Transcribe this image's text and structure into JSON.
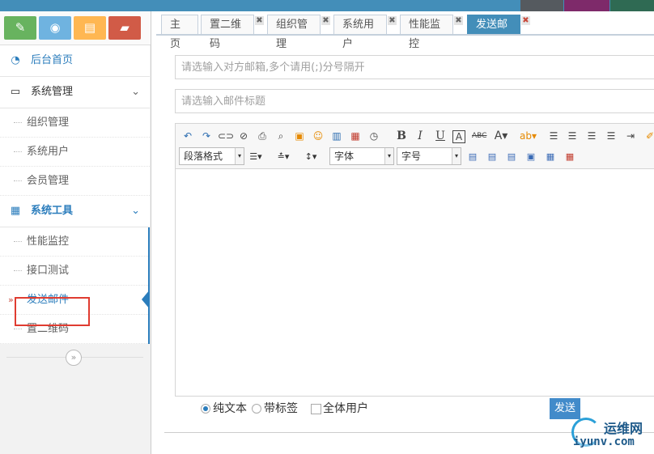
{
  "top_bar": {
    "colors": [
      "#438eb9",
      "#555a5f",
      "#7e2a6a",
      "#2f6a53"
    ]
  },
  "shortcuts": [
    {
      "icon": "pencil-icon",
      "glyph": "✎",
      "color": "#68b35f"
    },
    {
      "icon": "eye-icon",
      "glyph": "◉",
      "color": "#6fb3e0"
    },
    {
      "icon": "book-icon",
      "glyph": "▤",
      "color": "#ffb752"
    },
    {
      "icon": "folder-open-icon",
      "glyph": "▰",
      "color": "#d15b47"
    }
  ],
  "sidebar": {
    "home": {
      "label": "后台首页",
      "icon": "dashboard-icon",
      "glyph": "◔"
    },
    "system_management": {
      "label": "系统管理",
      "icon": "monitor-icon",
      "glyph": "▭",
      "items": [
        {
          "label": "组织管理"
        },
        {
          "label": "系统用户"
        },
        {
          "label": "会员管理"
        }
      ]
    },
    "system_tools": {
      "label": "系统工具",
      "icon": "grid-icon",
      "glyph": "▦",
      "items": [
        {
          "label": "性能监控"
        },
        {
          "label": "接口测试"
        },
        {
          "label": "发送邮件"
        },
        {
          "label": "置二维码"
        }
      ]
    },
    "chevron_glyph": "⌄",
    "collapse_glyph": "»",
    "active_marker": "»"
  },
  "tabs": [
    {
      "label": "主页",
      "closable": false
    },
    {
      "label": "置二维码",
      "closable": true
    },
    {
      "label": "组织管理",
      "closable": true
    },
    {
      "label": "系统用户",
      "closable": true
    },
    {
      "label": "性能监控",
      "closable": true
    },
    {
      "label": "发送邮件",
      "closable": true,
      "active": true
    }
  ],
  "tab_close_glyph": "✖",
  "form": {
    "to_placeholder": "请选输入对方邮箱,多个请用(;)分号隔开",
    "subject_placeholder": "请选输入邮件标题"
  },
  "editor": {
    "paragraph_format": "段落格式",
    "font_family": "字体",
    "font_size": "字号",
    "dropdown_glyph": "▾"
  },
  "options": {
    "plain_text": "纯文本",
    "with_tags": "带标签",
    "all_users": "全体用户",
    "selected": "plain_text"
  },
  "send_label": "发送",
  "watermark": {
    "cn": "运维网",
    "en": "iyunv.com"
  }
}
